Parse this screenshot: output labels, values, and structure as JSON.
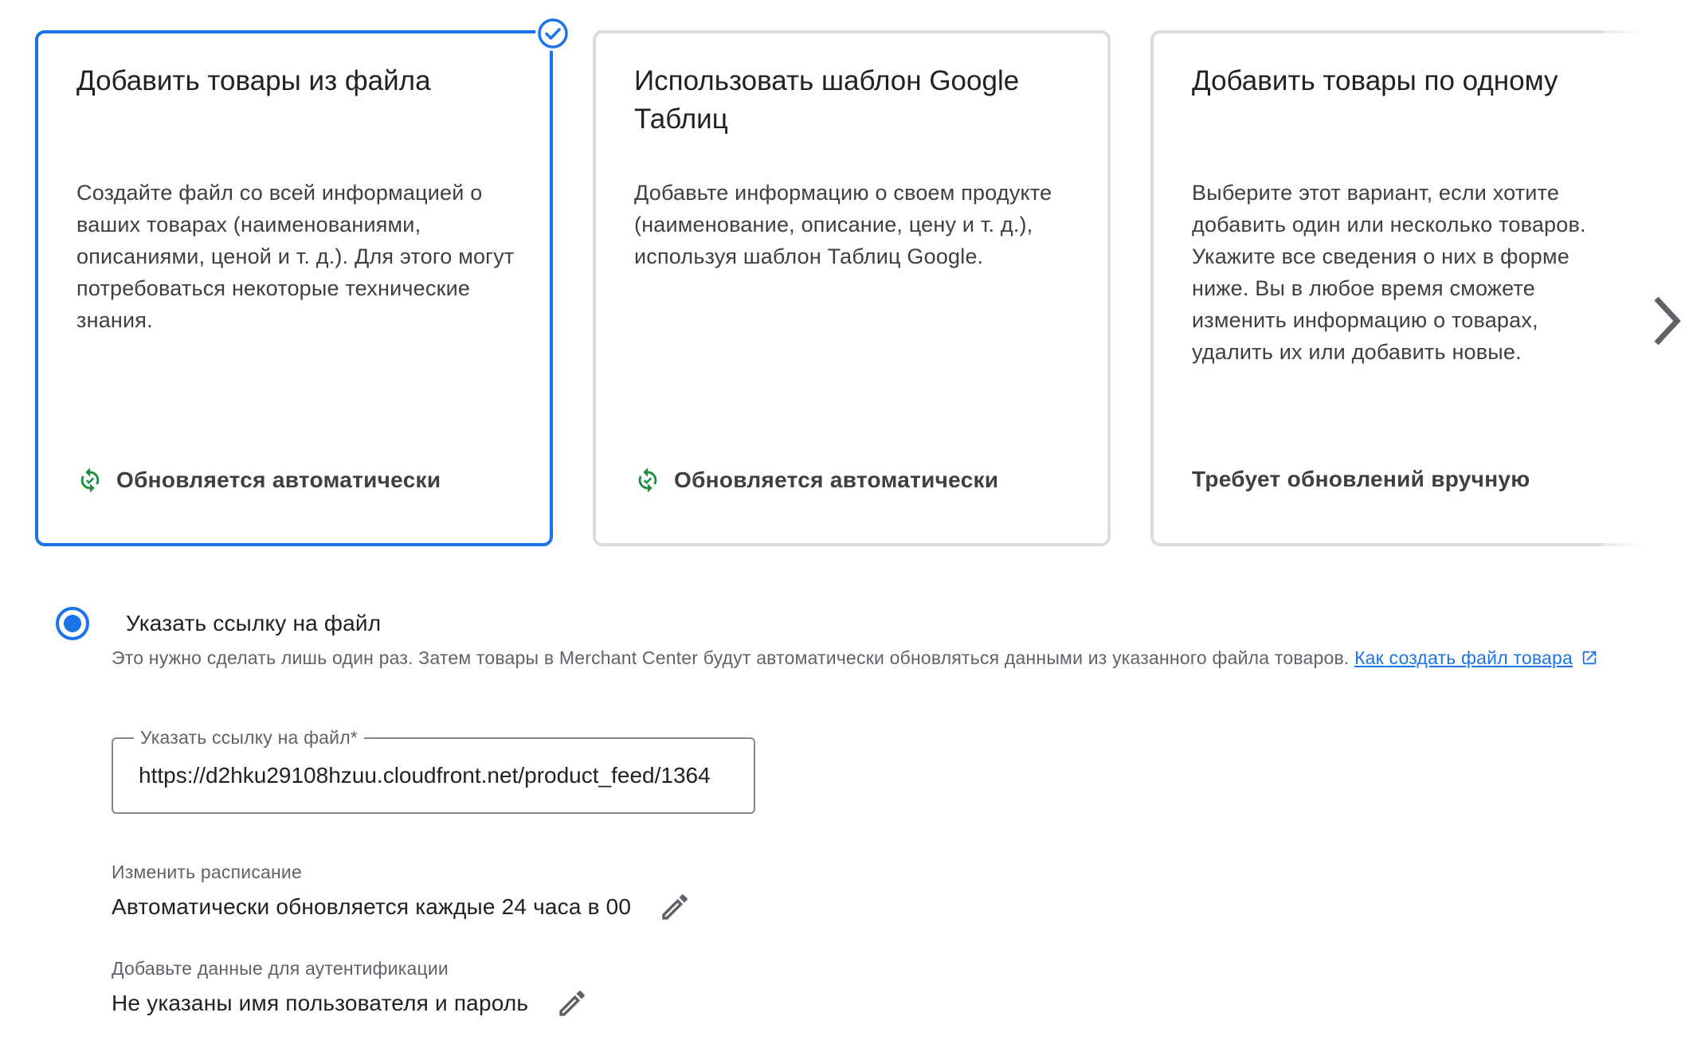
{
  "cards": [
    {
      "title": "Добавить товары из файла",
      "description": "Создайте файл со всей информацией о ваших товарах (наименованиями, описаниями, ценой и т. д.). Для этого могут потребоваться некоторые технические знания.",
      "footer": "Обновляется автоматически",
      "selected": true
    },
    {
      "title": "Использовать шаблон Google Таблиц",
      "description": "Добавьте информацию о своем продукте (наименование, описание, цену и т. д.), используя шаблон Таблиц Google.",
      "footer": "Обновляется автоматически",
      "selected": false
    },
    {
      "title": "Добавить товары по одному",
      "description_lines": [
        "Выберите этот вариант, если хотите",
        "добавить один или несколько товаров.",
        "Укажите все сведения о них в форме",
        "ниже. Вы в любое время сможете",
        "изменить информацию о товарах,",
        "удалить их или добавить новые."
      ],
      "footer": "Требует обновлений вручную",
      "selected": false
    }
  ],
  "option": {
    "label": "Указать ссылку на файл",
    "selected": true,
    "help_text": "Это нужно сделать лишь один раз. Затем товары в Merchant Center будут автоматически обновляться данными из указанного файла товаров.",
    "help_link": "Как создать файл товара"
  },
  "url_field": {
    "label": "Указать ссылку на файл*",
    "value": "https://d2hku29108hzuu.cloudfront.net/product_feed/1364"
  },
  "schedule": {
    "label": "Изменить расписание",
    "value": "Автоматически обновляется каждые 24 часа в 00"
  },
  "auth": {
    "label": "Добавьте данные для аутентификации",
    "value": "Не указаны имя пользователя и пароль"
  },
  "icons": {
    "sync": "sync-icon",
    "check": "check-circle-icon",
    "next": "chevron-right-icon",
    "external": "open-in-new-icon",
    "edit": "pencil-icon"
  },
  "colors": {
    "accent": "#1a73e8",
    "sync_green": "#1e8e3e",
    "card_border": "#dadce0"
  }
}
